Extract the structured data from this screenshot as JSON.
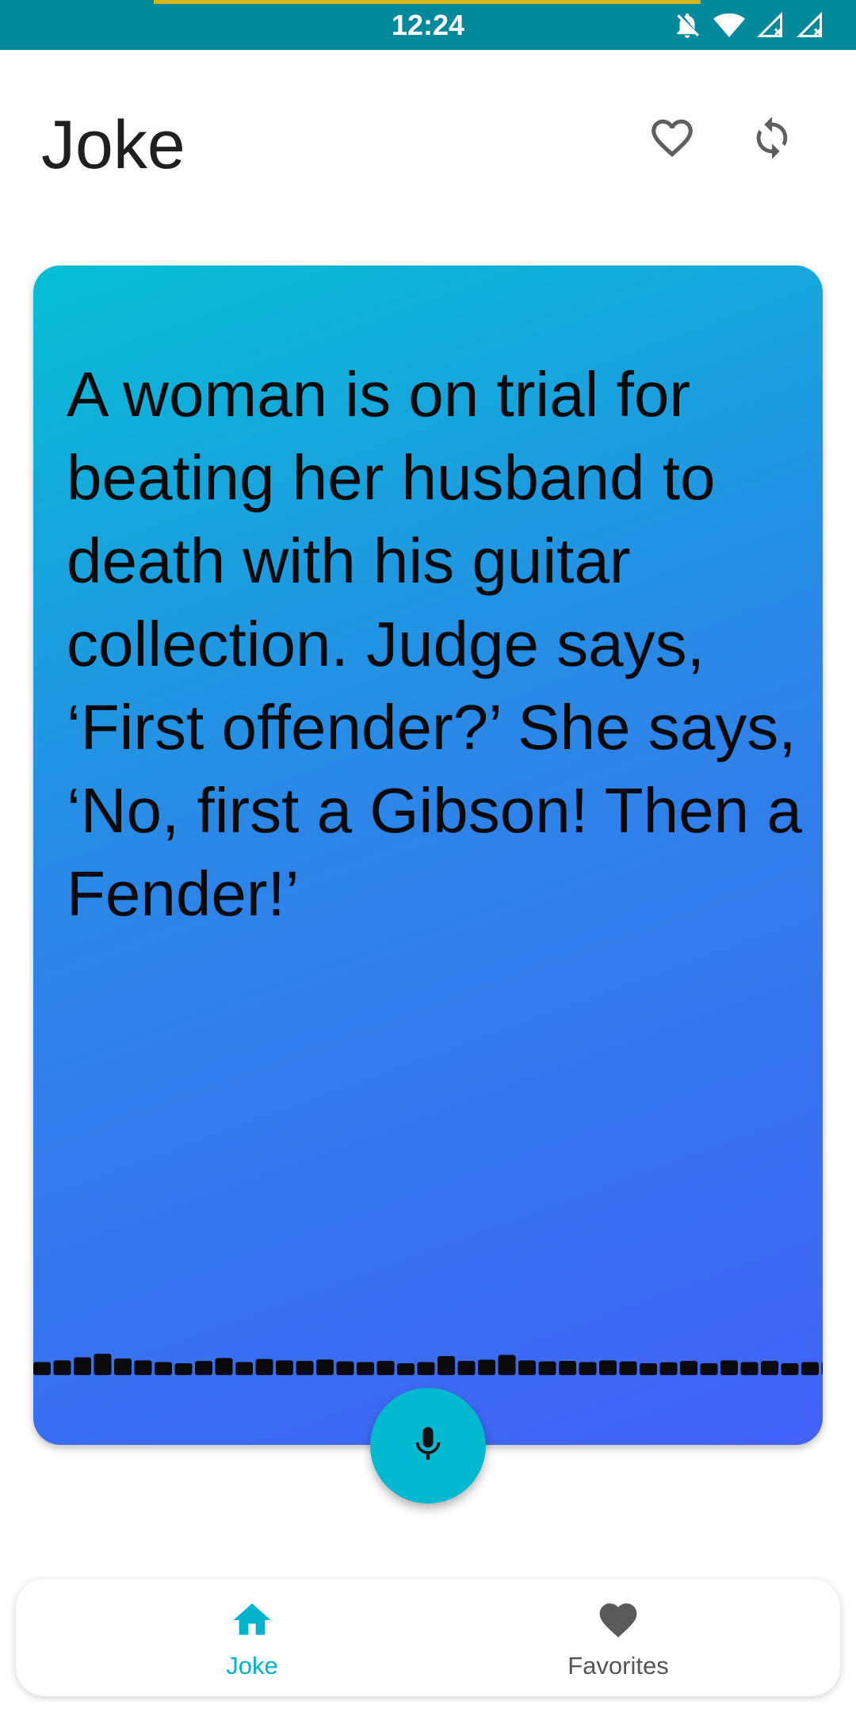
{
  "status_bar": {
    "time": "12:24",
    "icons": [
      "notifications-off-icon",
      "wifi-icon",
      "signal-no-data-icon",
      "signal-no-data-icon"
    ],
    "background": "#00899a",
    "progress_color": "#d6b51c"
  },
  "header": {
    "title": "Joke",
    "favorite_icon": "heart-outline-icon",
    "refresh_icon": "refresh-icon"
  },
  "card": {
    "joke": "A woman is on trial for beating her husband to death with his guitar collection. Judge says, ‘First offender?’ She says, ‘No, first a Gibson! Then a Fender!’",
    "gradient_start": "#05bfd4",
    "gradient_end": "#4261f8",
    "waveform_icon": "audio-waveform"
  },
  "mic_button": {
    "icon": "microphone-icon",
    "color": "#00b8d0"
  },
  "bottom_nav": {
    "items": [
      {
        "label": "Joke",
        "icon": "home-icon",
        "active": true,
        "color": "#00b3cc"
      },
      {
        "label": "Favorites",
        "icon": "heart-filled-icon",
        "active": false,
        "color": "#555555"
      }
    ]
  }
}
